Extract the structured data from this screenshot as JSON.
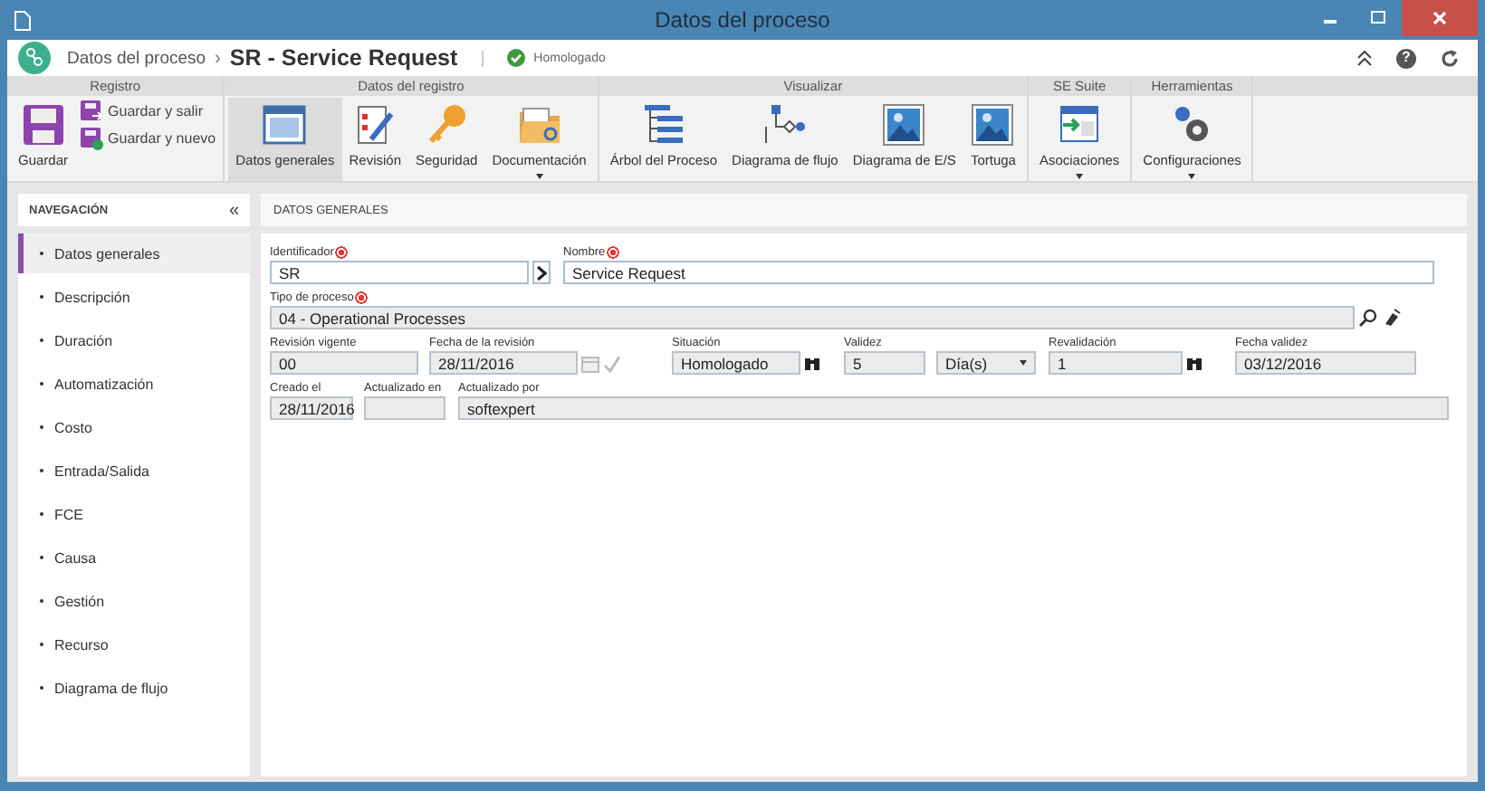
{
  "window": {
    "title": "Datos del proceso"
  },
  "header": {
    "breadcrumb": "Datos del proceso",
    "separator": "›",
    "title": "SR - Service Request",
    "status": "Homologado",
    "help": "?"
  },
  "ribbon": [
    {
      "title": "Registro",
      "buttons": [
        {
          "label": "Guardar",
          "kind": "large",
          "selected": false,
          "dropdown": false
        },
        {
          "label": "Guardar y salir",
          "kind": "small",
          "selected": false
        },
        {
          "label": "Guardar y nuevo",
          "kind": "small",
          "selected": false
        }
      ]
    },
    {
      "title": "Datos del registro",
      "buttons": [
        {
          "label": "Datos generales",
          "kind": "large",
          "selected": true,
          "dropdown": false
        },
        {
          "label": "Revisión",
          "kind": "large",
          "selected": false,
          "dropdown": false
        },
        {
          "label": "Seguridad",
          "kind": "large",
          "selected": false,
          "dropdown": false
        },
        {
          "label": "Documentación",
          "kind": "large",
          "selected": false,
          "dropdown": true
        }
      ]
    },
    {
      "title": "Visualizar",
      "buttons": [
        {
          "label": "Árbol del Proceso",
          "kind": "large",
          "selected": false,
          "dropdown": false
        },
        {
          "label": "Diagrama de flujo",
          "kind": "large",
          "selected": false,
          "dropdown": false
        },
        {
          "label": "Diagrama de E/S",
          "kind": "large",
          "selected": false,
          "dropdown": false
        },
        {
          "label": "Tortuga",
          "kind": "large",
          "selected": false,
          "dropdown": false
        }
      ]
    },
    {
      "title": "SE Suite",
      "buttons": [
        {
          "label": "Asociaciones",
          "kind": "large",
          "selected": false,
          "dropdown": true
        }
      ]
    },
    {
      "title": "Herramientas",
      "buttons": [
        {
          "label": "Configuraciones",
          "kind": "large",
          "selected": false,
          "dropdown": true
        }
      ]
    }
  ],
  "navigation": {
    "title": "NAVEGACIÓN",
    "collapse": "«",
    "items": [
      {
        "label": "Datos generales",
        "selected": true
      },
      {
        "label": "Descripción",
        "selected": false
      },
      {
        "label": "Duración",
        "selected": false
      },
      {
        "label": "Automatización",
        "selected": false
      },
      {
        "label": "Costo",
        "selected": false
      },
      {
        "label": "Entrada/Salida",
        "selected": false
      },
      {
        "label": "FCE",
        "selected": false
      },
      {
        "label": "Causa",
        "selected": false
      },
      {
        "label": "Gestión",
        "selected": false
      },
      {
        "label": "Recurso",
        "selected": false
      },
      {
        "label": "Diagrama de flujo",
        "selected": false
      }
    ]
  },
  "panel": {
    "title": "DATOS GENERALES",
    "rows": [
      [
        {
          "label": "Identificador",
          "value": "SR",
          "required": true,
          "disabled": false,
          "kind": "arrow"
        },
        {
          "label": "Nombre",
          "value": "Service Request",
          "required": true,
          "disabled": false,
          "kind": "text"
        }
      ],
      [
        {
          "label": "Tipo de proceso",
          "value": "04 - Operational Processes",
          "required": true,
          "disabled": true,
          "kind": "search"
        }
      ],
      [
        {
          "label": "Revisión vigente",
          "value": "00",
          "required": false,
          "disabled": true,
          "kind": "text"
        },
        {
          "label": "Fecha de la revisión",
          "value": "28/11/2016",
          "required": false,
          "disabled": true,
          "kind": "date"
        },
        {
          "label": "Situación",
          "value": "Homologado",
          "required": false,
          "disabled": true,
          "kind": "binoculars"
        },
        {
          "label": "Validez",
          "value": "5",
          "required": false,
          "disabled": true,
          "kind": "text"
        },
        {
          "value": "Día(s)",
          "disabled": true,
          "kind": "select"
        },
        {
          "label": "Revalidación",
          "value": "1",
          "required": false,
          "disabled": true,
          "kind": "binoculars"
        },
        {
          "label": "Fecha validez",
          "value": "03/12/2016",
          "required": false,
          "disabled": true,
          "kind": "text"
        }
      ],
      [
        {
          "label": "Creado el",
          "value": "28/11/2016",
          "required": false,
          "disabled": true,
          "kind": "text"
        },
        {
          "label": "Actualizado en",
          "required": false,
          "disabled": true,
          "kind": "text"
        },
        {
          "label": "Actualizado por",
          "value": "softexpert",
          "required": false,
          "disabled": true,
          "kind": "text"
        }
      ]
    ]
  }
}
